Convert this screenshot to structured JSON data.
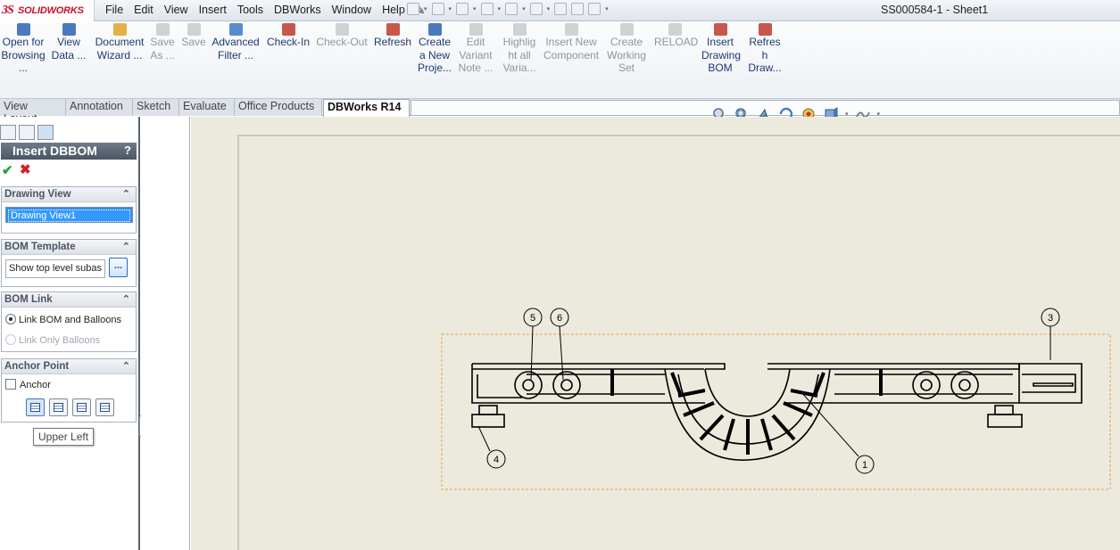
{
  "app": {
    "logo_ds": "3S",
    "logo_text": "SOLIDWORKS",
    "document_title": "SS000584-1 - Sheet1"
  },
  "menu": [
    "File",
    "Edit",
    "View",
    "Insert",
    "Tools",
    "DBWorks",
    "Window",
    "Help"
  ],
  "commands": [
    {
      "label": "Open for Browsing ...",
      "icon": "open-browsing-icon",
      "enabled": true
    },
    {
      "label": "View Data ...",
      "icon": "view-data-icon",
      "enabled": true
    },
    {
      "label": "Document Wizard ...",
      "icon": "document-wizard-icon",
      "enabled": true
    },
    {
      "label": "Save As ...",
      "icon": "save-as-icon",
      "enabled": false
    },
    {
      "label": "Save",
      "icon": "save-icon",
      "enabled": false
    },
    {
      "label": "Advanced Filter ...",
      "icon": "advanced-filter-icon",
      "enabled": true
    },
    {
      "label": "Check-In",
      "icon": "check-in-icon",
      "enabled": true
    },
    {
      "label": "Check-Out",
      "icon": "check-out-icon",
      "enabled": false
    },
    {
      "label": "Refresh",
      "icon": "refresh-icon",
      "enabled": true
    },
    {
      "label": "Create a New Proje...",
      "icon": "create-project-icon",
      "enabled": true
    },
    {
      "label": "Edit Variant Note ...",
      "icon": "edit-variant-icon",
      "enabled": false
    },
    {
      "label": "Highlight all Varia...",
      "icon": "highlight-variants-icon",
      "enabled": false
    },
    {
      "label": "Insert New Component",
      "icon": "insert-component-icon",
      "enabled": false
    },
    {
      "label": "Create Working Set",
      "icon": "working-set-icon",
      "enabled": false
    },
    {
      "label": "RELOAD",
      "icon": "reload-icon",
      "enabled": false
    },
    {
      "label": "Insert Drawing BOM",
      "icon": "insert-bom-icon",
      "enabled": true
    },
    {
      "label": "Refresh Draw...",
      "icon": "refresh-bom-icon",
      "enabled": true
    }
  ],
  "command_lines": [
    [
      "Open for",
      "Browsing",
      "..."
    ],
    [
      "View",
      "Data ..."
    ],
    [
      "Document",
      "Wizard ..."
    ],
    [
      "Save",
      "As ..."
    ],
    [
      "Save"
    ],
    [
      "Advanced",
      "Filter ..."
    ],
    [
      "Check-In"
    ],
    [
      "Check-Out"
    ],
    [
      "Refresh"
    ],
    [
      "Create",
      "a New",
      "Proje..."
    ],
    [
      "Edit",
      "Variant",
      "Note ..."
    ],
    [
      "Highlig",
      "ht all",
      "Varia..."
    ],
    [
      "Insert New",
      "Component"
    ],
    [
      "Create",
      "Working",
      "Set"
    ],
    [
      "RELOAD"
    ],
    [
      "Insert",
      "Drawing",
      "BOM"
    ],
    [
      "Refres",
      "h",
      "Draw..."
    ]
  ],
  "tabs": [
    "View Layout",
    "Annotation",
    "Sketch",
    "Evaluate",
    "Office Products",
    "DBWorks R14"
  ],
  "active_tab": "DBWorks R14",
  "property_manager": {
    "title": "Insert DBBOM",
    "help": "?",
    "drawing_view": {
      "header": "Drawing View",
      "selected": "Drawing View1"
    },
    "bom_template": {
      "header": "BOM Template",
      "value": "Show top level subas",
      "browse_label": "..."
    },
    "bom_link": {
      "header": "BOM Link",
      "option1": "Link BOM and Balloons",
      "option2": "Link Only Balloons",
      "selected": "Link BOM and Balloons"
    },
    "anchor_point": {
      "header": "Anchor Point",
      "checkbox_label": "Anchor",
      "checked": false
    },
    "tooltip": "Upper Left"
  },
  "balloons": [
    "1",
    "3",
    "4",
    "5",
    "6"
  ],
  "colors": {
    "accent": "#2f8cf0",
    "sw_red": "#c8102e",
    "graphics_bg": "#ebeadd",
    "bbox": "#e8a050"
  }
}
